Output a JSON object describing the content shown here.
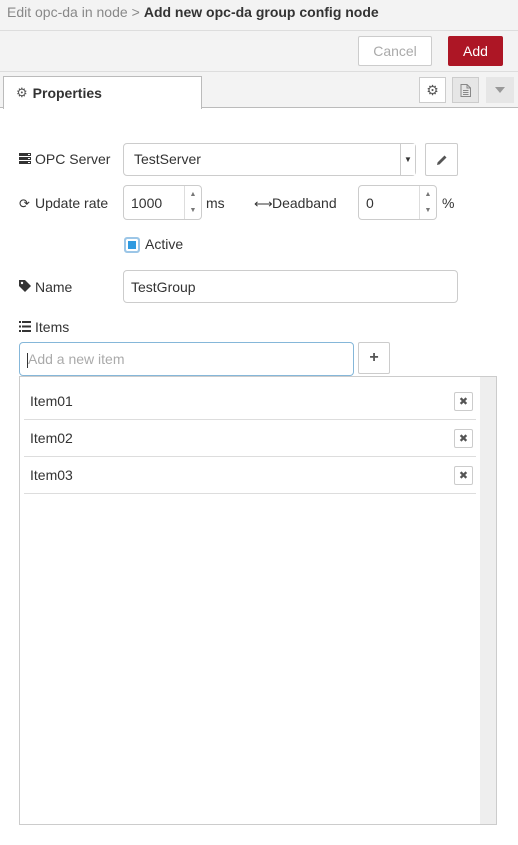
{
  "title": {
    "breadcrumb": "Edit opc-da in node",
    "separator": ">",
    "current": "Add new opc-da group config node"
  },
  "actions": {
    "cancel_label": "Cancel",
    "add_label": "Add",
    "add_color": "#ad1625"
  },
  "tabs": {
    "properties_label": "Properties",
    "properties_icon": "gear-icon"
  },
  "tab_buttons": [
    "gear-icon",
    "document-icon",
    "caret-down-icon"
  ],
  "form": {
    "opc_server": {
      "label": "OPC Server",
      "icon": "server-icon",
      "value": "TestServer"
    },
    "update_rate": {
      "label": "Update rate",
      "icon": "refresh-icon",
      "value": "1000",
      "unit": "ms"
    },
    "deadband": {
      "label": "Deadband",
      "icon": "arrows-h-icon",
      "value": "0",
      "unit": "%"
    },
    "active": {
      "label": "Active",
      "checked": true,
      "accent": "#2f9ae0"
    },
    "name": {
      "label": "Name",
      "icon": "tag-icon",
      "value": "TestGroup"
    },
    "items": {
      "label": "Items",
      "icon": "list-icon",
      "new_item_placeholder": "Add a new item",
      "list": [
        {
          "label": "Item01"
        },
        {
          "label": "Item02"
        },
        {
          "label": "Item03"
        }
      ]
    }
  }
}
